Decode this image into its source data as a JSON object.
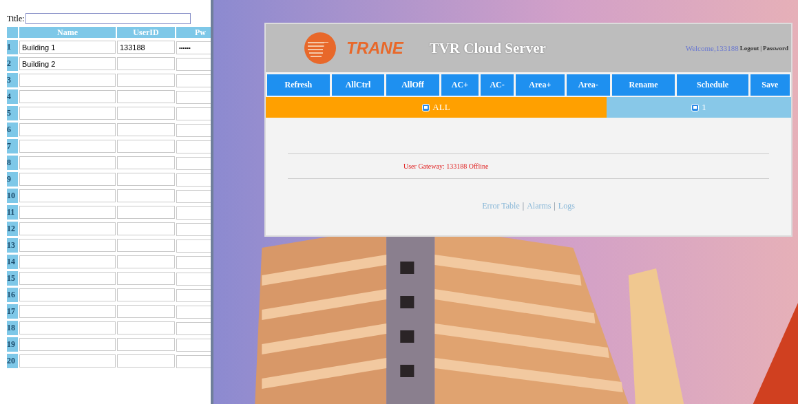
{
  "left_form": {
    "title_label": "Title:",
    "columns": [
      "Name",
      "UserID",
      "Pw"
    ],
    "rows": [
      {
        "index": "1",
        "name": "Building 1",
        "userid": "133188",
        "password": "••••••"
      },
      {
        "index": "2",
        "name": "Building 2"
      },
      {
        "index": "3"
      },
      {
        "index": "4"
      },
      {
        "index": "5"
      },
      {
        "index": "6"
      },
      {
        "index": "7"
      },
      {
        "index": "8"
      },
      {
        "index": "9"
      },
      {
        "index": "10"
      },
      {
        "index": "11"
      },
      {
        "index": "12"
      },
      {
        "index": "13"
      },
      {
        "index": "14"
      },
      {
        "index": "15"
      },
      {
        "index": "16"
      },
      {
        "index": "17"
      },
      {
        "index": "18"
      },
      {
        "index": "19"
      },
      {
        "index": "20"
      }
    ]
  },
  "header": {
    "brand": "TRANE",
    "title": "TVR Cloud Server",
    "welcome": "Welcome,133188",
    "links": [
      "Logout",
      "Password"
    ],
    "separator": "|"
  },
  "toolbar": [
    "Refresh",
    "AllCtrl",
    "AllOff",
    "AC+",
    "AC-",
    "Area+",
    "Area-",
    "Rename",
    "Schedule",
    "Save"
  ],
  "tabs": [
    {
      "label": "ALL",
      "selected": true
    },
    {
      "label": "1",
      "selected": false
    }
  ],
  "status": "User Gateway: 133188 Offline",
  "footer_links": [
    "Error Table",
    "Alarms",
    "Logs"
  ],
  "footer_separator": "|"
}
